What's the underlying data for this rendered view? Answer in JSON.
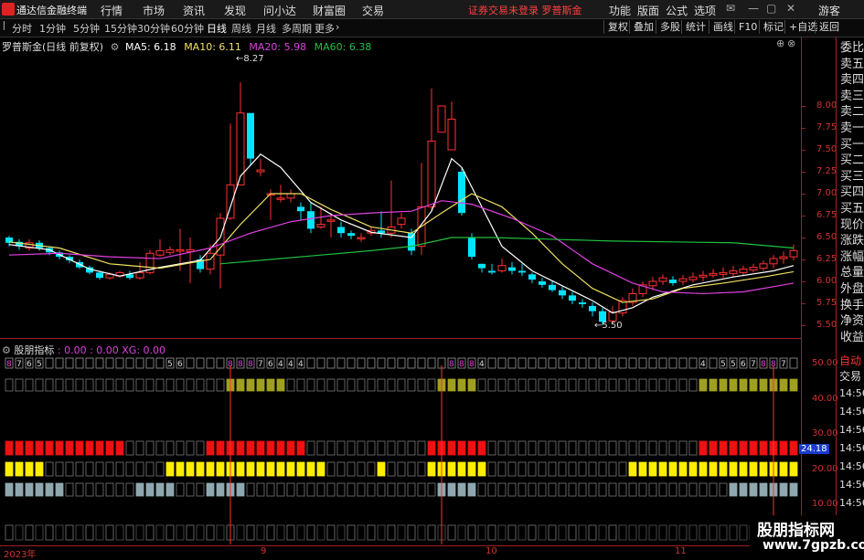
{
  "app": {
    "title": "通达信金融终端"
  },
  "menu": {
    "items": [
      "行情",
      "市场",
      "资讯",
      "发现",
      "问小达",
      "财富圈",
      "交易"
    ],
    "status": "证券交易未登录   罗普斯金",
    "right": [
      "功能",
      "版面",
      "公式",
      "选项",
      "游客"
    ]
  },
  "toolbar": {
    "periods": [
      "分时",
      "1分钟",
      "5分钟",
      "15分钟",
      "30分钟",
      "60分钟",
      "日线",
      "周线",
      "月线",
      "多周期",
      "更多"
    ],
    "active_period": "日线",
    "buttons": [
      "复权",
      "叠加",
      "多股",
      "统计",
      "画线",
      "F10",
      "标记",
      "+自选",
      "返回"
    ]
  },
  "chart_legend": {
    "name": "罗普斯金(日线 前复权)",
    "ma5": "MA5: 6.18",
    "ma10": "MA10: 6.11",
    "ma20": "MA20: 5.98",
    "ma60": "MA60: 6.38",
    "high_label": "8.27",
    "low_label": "5.50"
  },
  "indicator_legend": {
    "name": "股朋指标",
    "values": ": 0.00 : 0.00  XG: 0.00"
  },
  "right_side": {
    "items": [
      "委比",
      "卖五",
      "卖四",
      "卖三",
      "卖二",
      "卖一",
      "买一",
      "买二",
      "买三",
      "买四",
      "买五",
      "现价",
      "涨跌",
      "涨幅",
      "总量",
      "外盘",
      "换手",
      "净资",
      "收益"
    ],
    "tabs": [
      "自动",
      "交易"
    ],
    "times": [
      "14:56",
      "14:56",
      "14:56",
      "14:56",
      "14:56",
      "14:56",
      "14:56",
      "14:56"
    ]
  },
  "price_axis": [
    "8.00",
    "7.75",
    "7.50",
    "7.25",
    "7.00",
    "6.75",
    "6.50",
    "6.25",
    "6.00",
    "5.75",
    "5.50"
  ],
  "indicator_axis": [
    "50.00",
    "40.00",
    "30.00",
    "20.00",
    "10.00"
  ],
  "indicator_value": "24.18",
  "date_axis": [
    "2023年",
    "9",
    "10",
    "11"
  ],
  "watermark": {
    "line1": "股朋指标网",
    "line2": "www.7gpzb.com"
  },
  "colors": {
    "up": "#ff3232",
    "down": "#00e5ff",
    "ma5": "#ffffff",
    "ma10": "#f0e060",
    "ma20": "#e040e0",
    "ma60": "#20c040",
    "axis": "#a02020"
  },
  "chart_data": {
    "type": "candlestick",
    "ylim": [
      5.4,
      8.4
    ],
    "candles": [
      [
        6.5,
        6.44,
        6.52,
        6.4
      ],
      [
        6.45,
        6.4,
        6.48,
        6.36
      ],
      [
        6.38,
        6.44,
        6.48,
        6.35
      ],
      [
        6.44,
        6.38,
        6.47,
        6.35
      ],
      [
        6.38,
        6.33,
        6.4,
        6.3
      ],
      [
        6.33,
        6.28,
        6.35,
        6.25
      ],
      [
        6.28,
        6.24,
        6.3,
        6.21
      ],
      [
        6.22,
        6.16,
        6.25,
        6.14
      ],
      [
        6.16,
        6.1,
        6.18,
        6.08
      ],
      [
        6.1,
        6.04,
        6.12,
        6.02
      ],
      [
        6.04,
        6.08,
        6.1,
        6.02
      ],
      [
        6.06,
        6.1,
        6.12,
        6.04
      ],
      [
        6.08,
        6.04,
        6.12,
        6.02
      ],
      [
        6.04,
        6.1,
        6.22,
        6.02
      ],
      [
        6.1,
        6.32,
        6.36,
        6.08
      ],
      [
        6.3,
        6.35,
        6.48,
        6.28
      ],
      [
        6.33,
        6.36,
        6.4,
        6.3
      ],
      [
        6.35,
        6.36,
        6.6,
        6.12
      ],
      [
        6.34,
        6.36,
        6.5,
        5.98
      ],
      [
        6.25,
        6.14,
        6.3,
        6.1
      ],
      [
        6.14,
        6.32,
        6.42,
        6.08
      ],
      [
        6.3,
        6.72,
        6.78,
        5.92
      ],
      [
        6.72,
        7.1,
        7.8,
        6.7
      ],
      [
        7.1,
        7.92,
        8.27,
        7.85
      ],
      [
        7.92,
        7.4,
        7.7,
        7.32
      ],
      [
        7.25,
        7.27,
        7.4,
        7.2
      ],
      [
        7.0,
        7.0,
        7.05,
        6.7
      ],
      [
        6.95,
        6.95,
        7.1,
        6.9
      ],
      [
        6.95,
        7.0,
        7.05,
        6.9
      ],
      [
        6.85,
        6.8,
        6.9,
        6.7
      ],
      [
        6.8,
        6.6,
        6.9,
        6.55
      ],
      [
        6.62,
        6.65,
        6.85,
        6.6
      ],
      [
        6.7,
        6.7,
        6.78,
        6.5
      ],
      [
        6.62,
        6.55,
        6.68,
        6.5
      ],
      [
        6.55,
        6.52,
        6.58,
        6.48
      ],
      [
        6.5,
        6.5,
        6.55,
        6.45
      ],
      [
        6.55,
        6.58,
        6.62,
        6.52
      ],
      [
        6.58,
        6.55,
        6.8,
        6.5
      ],
      [
        6.55,
        6.62,
        7.15,
        6.5
      ],
      [
        6.65,
        6.72,
        6.78,
        6.6
      ],
      [
        6.55,
        6.35,
        6.6,
        6.3
      ],
      [
        6.4,
        6.85,
        7.35,
        6.3
      ],
      [
        6.85,
        7.6,
        8.2,
        6.8
      ],
      [
        7.7,
        8.0,
        8.0,
        7.7
      ],
      [
        7.5,
        7.85,
        8.05,
        7.5
      ],
      [
        7.25,
        6.78,
        7.3,
        6.75
      ],
      [
        6.5,
        6.28,
        6.55,
        6.25
      ],
      [
        6.2,
        6.15,
        6.2,
        6.1
      ],
      [
        6.12,
        6.1,
        6.2,
        6.08
      ],
      [
        6.12,
        6.18,
        6.26,
        6.1
      ],
      [
        6.16,
        6.12,
        6.22,
        6.08
      ],
      [
        6.12,
        6.1,
        6.2,
        6.06
      ],
      [
        6.08,
        6.02,
        6.1,
        5.98
      ],
      [
        6.0,
        5.96,
        6.04,
        5.93
      ],
      [
        5.96,
        5.9,
        6.0,
        5.88
      ],
      [
        5.9,
        5.84,
        5.94,
        5.8
      ],
      [
        5.84,
        5.78,
        5.88,
        5.74
      ],
      [
        5.76,
        5.74,
        5.8,
        5.7
      ],
      [
        5.72,
        5.66,
        5.76,
        5.6
      ],
      [
        5.66,
        5.54,
        5.7,
        5.5
      ],
      [
        5.55,
        5.65,
        5.72,
        5.53
      ],
      [
        5.64,
        5.78,
        5.82,
        5.6
      ],
      [
        5.76,
        5.86,
        5.92,
        5.72
      ],
      [
        5.86,
        5.96,
        6.0,
        5.82
      ],
      [
        5.95,
        6.0,
        6.05,
        5.9
      ],
      [
        6.0,
        6.04,
        6.08,
        5.96
      ],
      [
        6.02,
        5.98,
        6.06,
        5.95
      ],
      [
        6.0,
        6.03,
        6.07,
        5.96
      ],
      [
        6.02,
        6.05,
        6.1,
        5.99
      ],
      [
        6.05,
        6.07,
        6.12,
        6.0
      ],
      [
        6.07,
        6.09,
        6.14,
        6.04
      ],
      [
        6.08,
        6.1,
        6.16,
        6.04
      ],
      [
        6.09,
        6.12,
        6.18,
        6.05
      ],
      [
        6.1,
        6.14,
        6.18,
        6.06
      ],
      [
        6.13,
        6.16,
        6.2,
        6.1
      ],
      [
        6.15,
        6.2,
        6.24,
        6.12
      ],
      [
        6.2,
        6.26,
        6.3,
        6.15
      ],
      [
        6.26,
        6.28,
        6.34,
        6.2
      ],
      [
        6.28,
        6.35,
        6.42,
        6.24
      ]
    ],
    "ma_series": {
      "ma5": [
        [
          0,
          6.42
        ],
        [
          4,
          6.36
        ],
        [
          8,
          6.14
        ],
        [
          11,
          6.06
        ],
        [
          15,
          6.16
        ],
        [
          19,
          6.24
        ],
        [
          21,
          6.5
        ],
        [
          23,
          7.2
        ],
        [
          25,
          7.45
        ],
        [
          27,
          7.3
        ],
        [
          30,
          6.9
        ],
        [
          33,
          6.7
        ],
        [
          36,
          6.56
        ],
        [
          40,
          6.5
        ],
        [
          42,
          6.8
        ],
        [
          44,
          7.4
        ],
        [
          45,
          7.3
        ],
        [
          47,
          6.85
        ],
        [
          49,
          6.4
        ],
        [
          52,
          6.12
        ],
        [
          55,
          5.95
        ],
        [
          58,
          5.78
        ],
        [
          60,
          5.64
        ],
        [
          62,
          5.7
        ],
        [
          64,
          5.82
        ],
        [
          68,
          5.96
        ],
        [
          72,
          6.05
        ],
        [
          76,
          6.12
        ],
        [
          78,
          6.18
        ]
      ],
      "ma10": [
        [
          0,
          6.45
        ],
        [
          5,
          6.38
        ],
        [
          10,
          6.2
        ],
        [
          15,
          6.15
        ],
        [
          20,
          6.25
        ],
        [
          23,
          6.65
        ],
        [
          26,
          7.0
        ],
        [
          29,
          7.0
        ],
        [
          32,
          6.82
        ],
        [
          36,
          6.62
        ],
        [
          40,
          6.55
        ],
        [
          43,
          6.78
        ],
        [
          46,
          7.0
        ],
        [
          49,
          6.85
        ],
        [
          52,
          6.55
        ],
        [
          55,
          6.2
        ],
        [
          58,
          5.92
        ],
        [
          61,
          5.76
        ],
        [
          64,
          5.8
        ],
        [
          67,
          5.92
        ],
        [
          71,
          5.98
        ],
        [
          75,
          6.05
        ],
        [
          78,
          6.11
        ]
      ],
      "ma20": [
        [
          0,
          6.3
        ],
        [
          5,
          6.32
        ],
        [
          10,
          6.28
        ],
        [
          15,
          6.26
        ],
        [
          20,
          6.38
        ],
        [
          24,
          6.55
        ],
        [
          28,
          6.68
        ],
        [
          32,
          6.75
        ],
        [
          36,
          6.78
        ],
        [
          40,
          6.8
        ],
        [
          43,
          6.92
        ],
        [
          46,
          6.88
        ],
        [
          50,
          6.72
        ],
        [
          54,
          6.52
        ],
        [
          58,
          6.2
        ],
        [
          62,
          5.98
        ],
        [
          65,
          5.88
        ],
        [
          69,
          5.86
        ],
        [
          73,
          5.88
        ],
        [
          78,
          5.98
        ]
      ],
      "ma60": [
        [
          21,
          6.2
        ],
        [
          26,
          6.25
        ],
        [
          31,
          6.3
        ],
        [
          36,
          6.35
        ],
        [
          40,
          6.4
        ],
        [
          44,
          6.5
        ],
        [
          48,
          6.5
        ],
        [
          54,
          6.48
        ],
        [
          60,
          6.46
        ],
        [
          66,
          6.45
        ],
        [
          72,
          6.44
        ],
        [
          78,
          6.38
        ]
      ]
    },
    "indicator": {
      "number_row": [
        "8",
        "7",
        "6",
        "5",
        "",
        "",
        "",
        "",
        "",
        "",
        "",
        "",
        "",
        "",
        "",
        "",
        "5",
        "6",
        "",
        "",
        "",
        "",
        "8",
        "8",
        "8",
        "7",
        "6",
        "4",
        "4",
        "4",
        "",
        "",
        "",
        "",
        "",
        "",
        "",
        "",
        "",
        "",
        "",
        "",
        "",
        "",
        "8",
        "8",
        "8",
        "4",
        "",
        "",
        "",
        "",
        "",
        "",
        "",
        "",
        "",
        "",
        "",
        "",
        "",
        "",
        "",
        "",
        "",
        "",
        "",
        "",
        "",
        "4",
        "",
        "5",
        "5",
        "6",
        "7",
        "8",
        "8",
        "7"
      ],
      "ylim": [
        8,
        55
      ]
    }
  }
}
